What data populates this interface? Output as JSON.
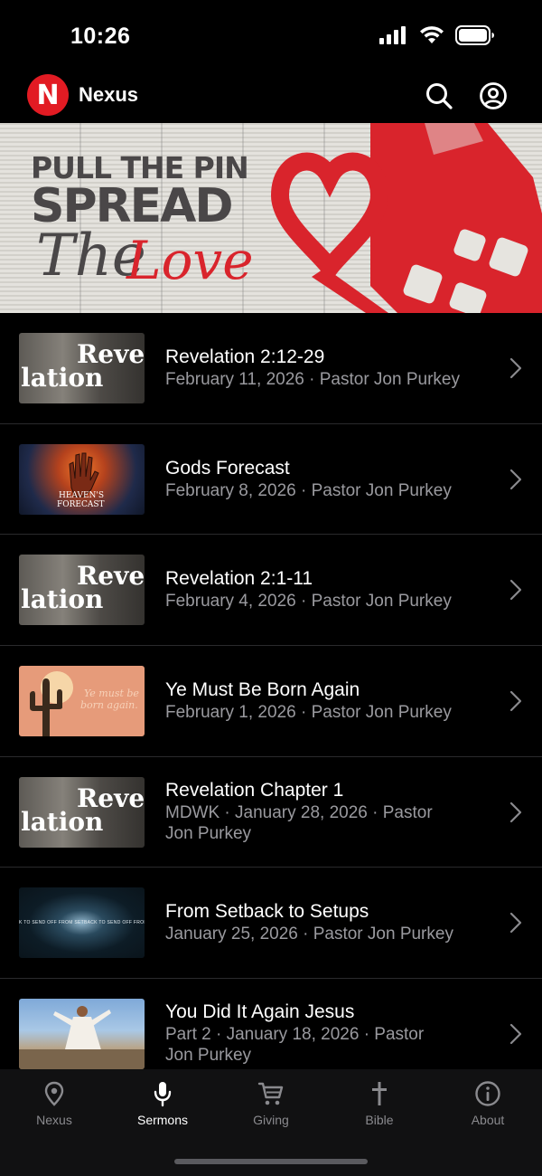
{
  "status_bar": {
    "time": "10:26"
  },
  "app": {
    "name": "Nexus",
    "logo_letter": "N",
    "accent": "#e21b23"
  },
  "banner": {
    "line1": "PULL THE PIN",
    "line2": "SPREAD",
    "script_the": "The",
    "script_love": "Love"
  },
  "sermons": [
    {
      "title": "Revelation 2:12-29",
      "subtitle": "February 11, 2026 · Pastor Jon Purkey",
      "thumb": "revelation"
    },
    {
      "title": "Gods Forecast",
      "subtitle": "February 8, 2026 · Pastor Jon Purkey",
      "thumb": "heavens-forecast",
      "thumb_text_1": "HEAVEN'S",
      "thumb_text_2": "FORECAST"
    },
    {
      "title": "Revelation 2:1-11",
      "subtitle": "February 4, 2026 · Pastor Jon Purkey",
      "thumb": "revelation"
    },
    {
      "title": "Ye Must Be Born Again",
      "subtitle": "February 1, 2026 · Pastor Jon Purkey",
      "thumb": "born-again",
      "thumb_text_1": "Ye must be",
      "thumb_text_2": "born again."
    },
    {
      "title": "Revelation Chapter 1",
      "subtitle_line1": "MDWK · January 28, 2026 · Pastor",
      "subtitle_line2": "Jon Purkey",
      "thumb": "revelation"
    },
    {
      "title": "From Setback to Setups",
      "subtitle": "January 25, 2026 · Pastor Jon Purkey",
      "thumb": "setback",
      "thumb_text_1": "K TO SEND OFF   FROM SETBACK TO SEND OFF   FROM SETBACK"
    },
    {
      "title": "You Did It Again Jesus",
      "subtitle_line1": "Part 2 · January 18, 2026 · Pastor",
      "subtitle_line2": "Jon Purkey",
      "thumb": "jesus"
    }
  ],
  "revelation_thumb": {
    "top": "Reve",
    "bottom": "lation"
  },
  "tabs": [
    {
      "label": "Nexus",
      "icon": "location-pin-icon",
      "active": false
    },
    {
      "label": "Sermons",
      "icon": "microphone-icon",
      "active": true
    },
    {
      "label": "Giving",
      "icon": "cart-icon",
      "active": false
    },
    {
      "label": "Bible",
      "icon": "cross-icon",
      "active": false
    },
    {
      "label": "About",
      "icon": "info-icon",
      "active": false
    }
  ]
}
